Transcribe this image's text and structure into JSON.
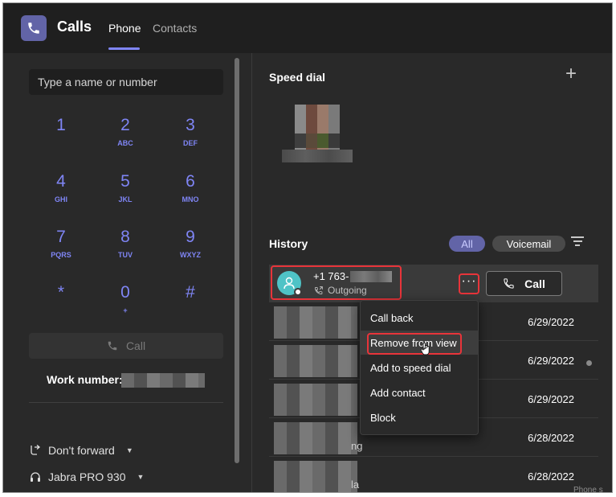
{
  "header": {
    "app_title": "Calls",
    "tabs": [
      {
        "label": "Phone",
        "active": true
      },
      {
        "label": "Contacts",
        "active": false
      }
    ],
    "accent_color": "#7f85f5",
    "brand_color": "#6264a7"
  },
  "dialpad": {
    "search_placeholder": "Type a name or number",
    "keys": [
      {
        "digit": "1",
        "letters": ""
      },
      {
        "digit": "2",
        "letters": "ABC"
      },
      {
        "digit": "3",
        "letters": "DEF"
      },
      {
        "digit": "4",
        "letters": "GHI"
      },
      {
        "digit": "5",
        "letters": "JKL"
      },
      {
        "digit": "6",
        "letters": "MNO"
      },
      {
        "digit": "7",
        "letters": "PQRS"
      },
      {
        "digit": "8",
        "letters": "TUV"
      },
      {
        "digit": "9",
        "letters": "WXYZ"
      },
      {
        "digit": "*",
        "letters": ""
      },
      {
        "digit": "0",
        "letters": "+"
      },
      {
        "digit": "#",
        "letters": ""
      }
    ],
    "call_label": "Call",
    "work_number_label": "Work number:",
    "forward_label": "Don't forward",
    "device_label": "Jabra PRO 930"
  },
  "speed_dial": {
    "title": "Speed dial"
  },
  "history": {
    "title": "History",
    "filters": [
      {
        "label": "All",
        "active": true
      },
      {
        "label": "Voicemail",
        "active": false
      }
    ],
    "selected_row": {
      "number": "+1 763-",
      "direction": "Outgoing",
      "call_label": "Call"
    },
    "rows": [
      {
        "date": "6/29/2022",
        "partial_text": ""
      },
      {
        "date": "6/29/2022",
        "partial_text": ""
      },
      {
        "date": "6/29/2022",
        "partial_text": ""
      },
      {
        "date": "6/28/2022",
        "partial_text": "ng"
      },
      {
        "date": "6/28/2022",
        "partial_text": "la"
      }
    ]
  },
  "context_menu": {
    "items": [
      {
        "label": "Call back"
      },
      {
        "label": "Remove from view"
      },
      {
        "label": "Add to speed dial"
      },
      {
        "label": "Add contact"
      },
      {
        "label": "Block"
      }
    ],
    "highlighted_item": "Remove from view",
    "highlight_color": "#e8343a"
  },
  "partial_bottom_text": "Phone s"
}
